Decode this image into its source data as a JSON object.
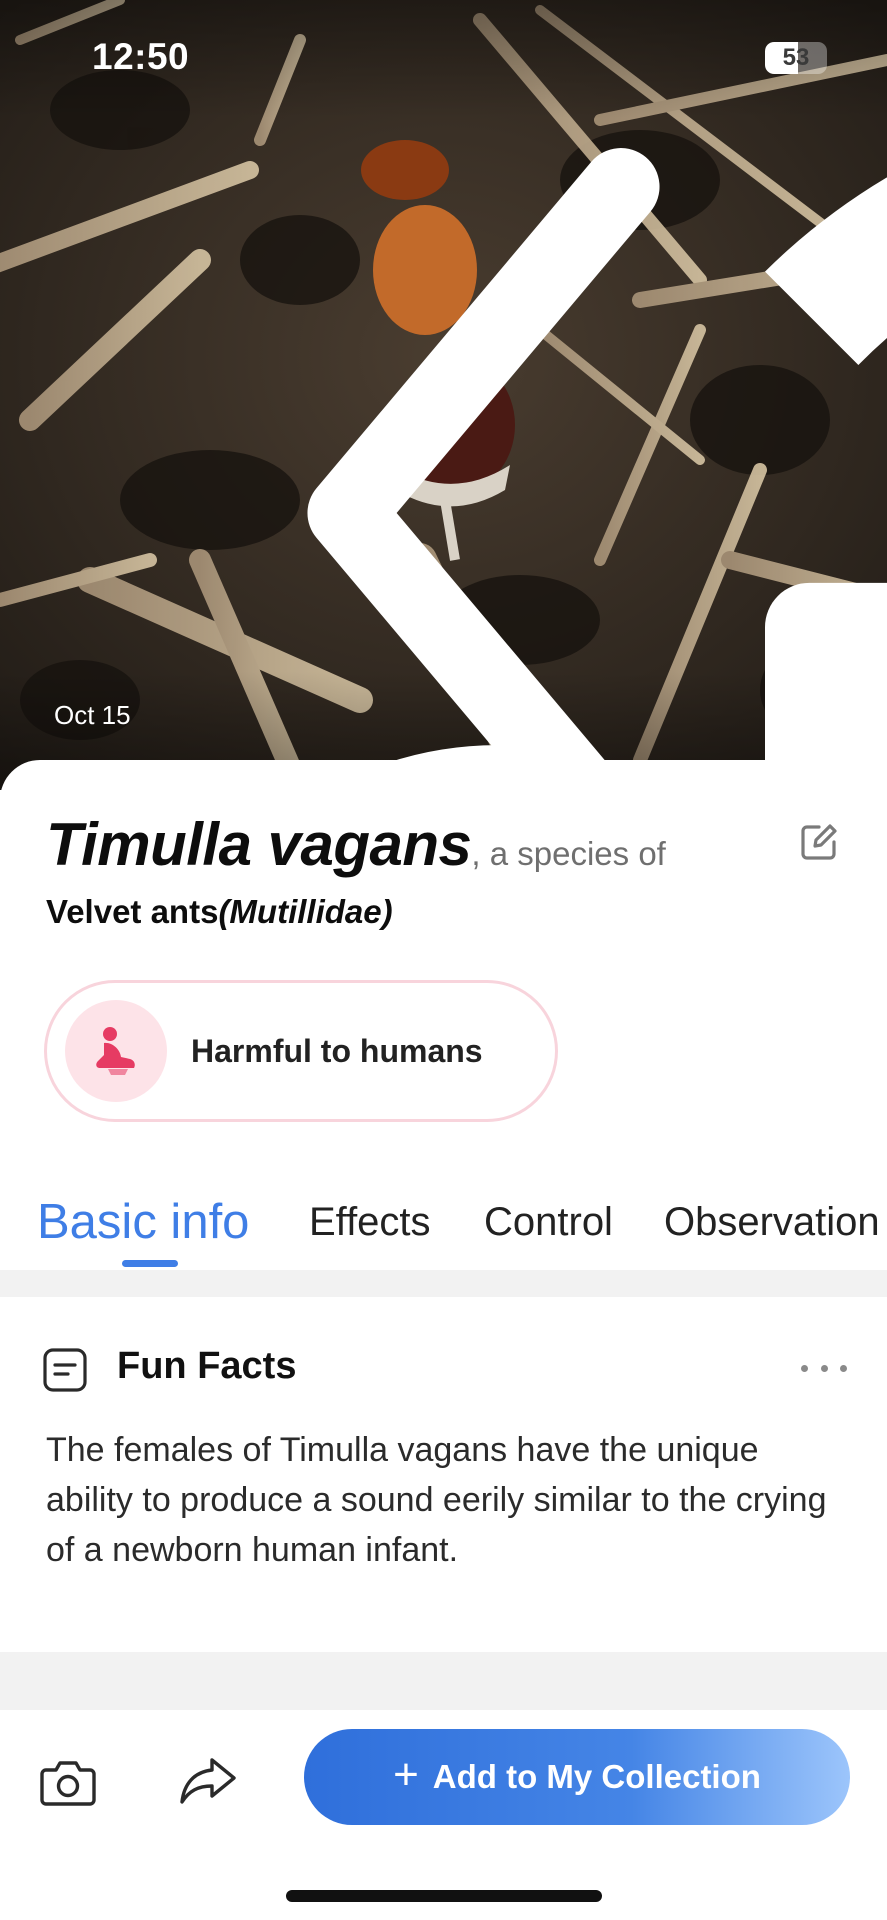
{
  "status_bar": {
    "time": "12:50",
    "battery": "53",
    "battery_level": 0.53,
    "icons": [
      "signal-icon",
      "wifi-icon",
      "battery-icon"
    ]
  },
  "photo": {
    "date": "Oct 15",
    "icons": [
      "back-chevron-icon",
      "clock-icon"
    ]
  },
  "species": {
    "scientific_name": "Timulla vagans",
    "species_of": ", a species of",
    "family_common": "Velvet ants",
    "family_latin": "(Mutillidae)"
  },
  "harm_badge": {
    "label": "Harmful to humans",
    "icon": "harmful-person-icon",
    "color": "#e63b63"
  },
  "tabs": [
    {
      "label": "Basic info",
      "active": true
    },
    {
      "label": "Effects",
      "active": false
    },
    {
      "label": "Control",
      "active": false
    },
    {
      "label": "Observation",
      "active": false
    }
  ],
  "fun_facts": {
    "title": "Fun Facts",
    "icon": "note-icon",
    "body": "The females of Timulla vagans have the unique ability to produce a sound eerily similar to the crying of a newborn human infant."
  },
  "bottom_bar": {
    "add_label": "Add to My Collection",
    "icons": [
      "camera-icon",
      "share-icon",
      "plus-icon"
    ]
  },
  "colors": {
    "accent": "#3f7ee6",
    "harm_accent": "#e63b63",
    "harm_bg": "#fde3e8"
  }
}
